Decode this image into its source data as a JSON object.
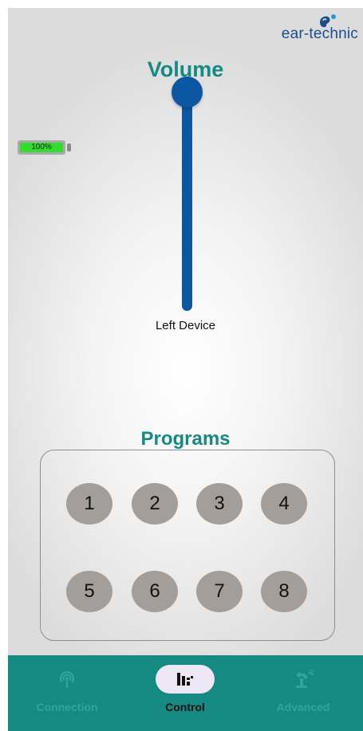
{
  "brand": {
    "logo_text": "ear-technic",
    "icon": "ear-logo-icon",
    "color": "#1a4e8c"
  },
  "volume": {
    "title": "Volume",
    "level": 1.0,
    "device_label": "Left Device",
    "accent": "#0b57a4"
  },
  "battery": {
    "label": "100%",
    "level": 1.0,
    "fill_color": "#2ee02a"
  },
  "programs": {
    "title": "Programs",
    "buttons": [
      "1",
      "2",
      "3",
      "4",
      "5",
      "6",
      "7",
      "8"
    ]
  },
  "nav": {
    "items": [
      {
        "label": "Connection",
        "icon": "signal-icon",
        "active": false
      },
      {
        "label": "Control",
        "icon": "equalizer-icon",
        "active": true
      },
      {
        "label": "Advanced",
        "icon": "robot-arm-icon",
        "active": false
      }
    ],
    "color": "#148a82"
  },
  "colors": {
    "title_teal": "#148a82",
    "program_button": "#a39e9a"
  }
}
